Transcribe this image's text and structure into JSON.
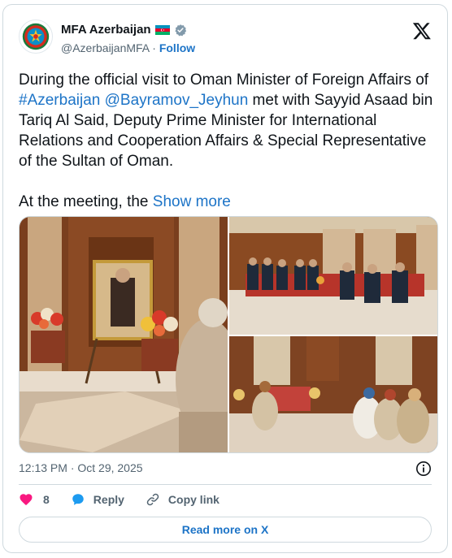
{
  "author": {
    "display_name": "MFA Azerbaijan",
    "handle": "@AzerbaijanMFA",
    "separator": "·",
    "follow_label": "Follow"
  },
  "tweet": {
    "text_1": "During the official visit to Oman Minister of Foreign Affairs of ",
    "hashtag": "#Azerbaijan",
    "space": " ",
    "mention": "@Bayramov_Jeyhun",
    "text_2": " met with Sayyid Asaad bin Tariq Al Said, Deputy Prime Minister for International Relations and Cooperation Affairs & Special Representative of the Sultan of Oman.",
    "text_3": "At the meeting, the ",
    "show_more": "Show more"
  },
  "media": {
    "photo_count": 3
  },
  "meta": {
    "timestamp": "12:13 PM · Oct 29, 2025"
  },
  "actions": {
    "like_count": "8",
    "reply_label": "Reply",
    "copy_link_label": "Copy link"
  },
  "read_more_label": "Read more on X",
  "colors": {
    "link": "#1d74c7",
    "like": "#f91880",
    "verified": "#1d9bf0",
    "border": "#cfd9de",
    "secondary_text": "#536471"
  },
  "icons": [
    "x-logo-icon",
    "verified-badge-icon",
    "azerbaijan-flag-icon",
    "info-icon",
    "heart-icon",
    "reply-bubble-icon",
    "link-icon"
  ]
}
